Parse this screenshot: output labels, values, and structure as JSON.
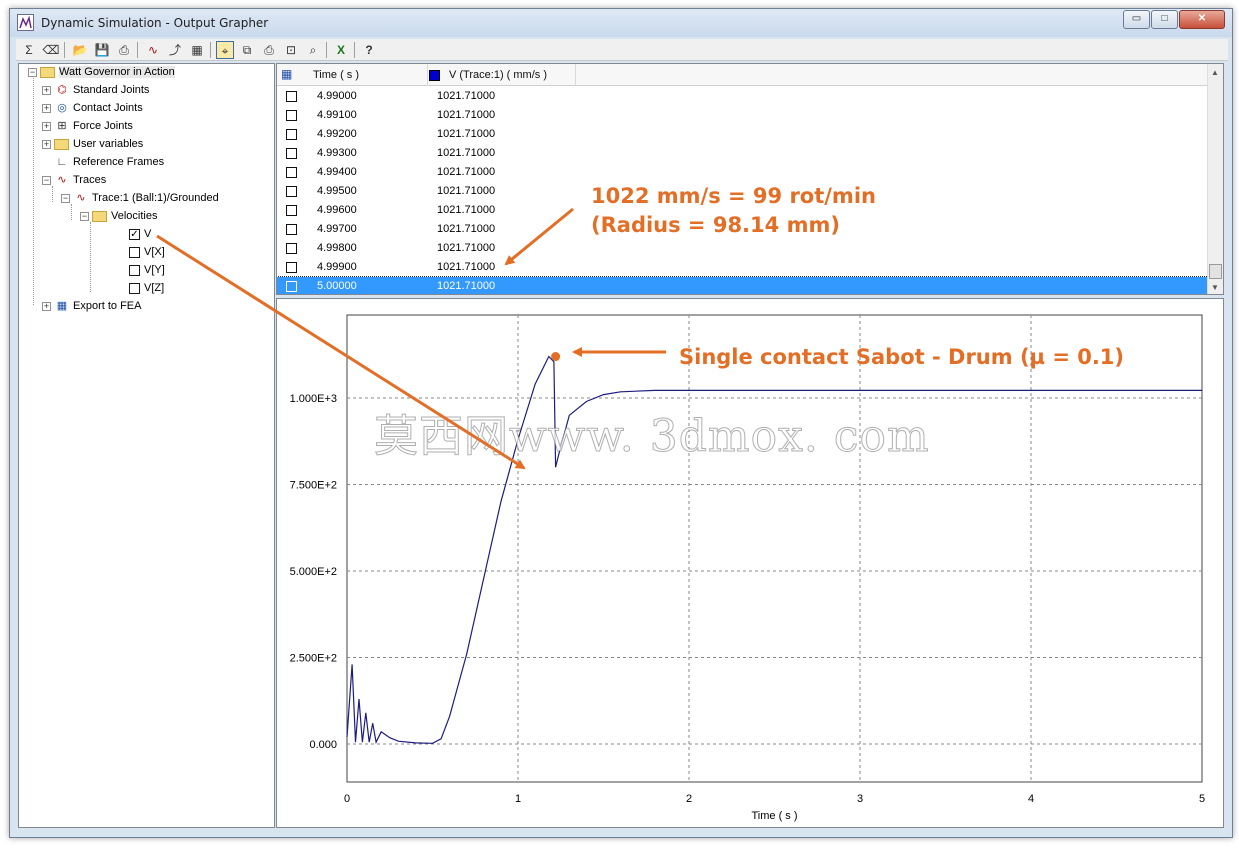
{
  "window": {
    "title": "Dynamic Simulation - Output Grapher",
    "controls": [
      "▭",
      "□",
      "✕"
    ]
  },
  "toolbar": {
    "icons": [
      "calc-icon",
      "eraser-icon",
      "open-icon",
      "save-icon",
      "export-icon",
      "trace-icon",
      "add-axis-icon",
      "fea-icon",
      "curve-select-icon",
      "copy-icon",
      "print-icon",
      "zoom-fit-icon",
      "zoom-icon",
      "excel-icon",
      "help-icon"
    ],
    "glyphs": [
      "Σ",
      "⌫",
      "📂",
      "💾",
      "⎙",
      "∿",
      "⤴",
      "▦",
      "⌖",
      "⧉",
      "⎙",
      "⊡",
      "⌕",
      "X",
      "?"
    ]
  },
  "tree": {
    "root": "Watt Governor in Action",
    "items": {
      "standard_joints": "Standard Joints",
      "contact_joints": "Contact Joints",
      "force_joints": "Force Joints",
      "user_variables": "User variables",
      "reference_frames": "Reference Frames",
      "traces": "Traces",
      "trace1": "Trace:1 (Ball:1)/Grounded",
      "velocities": "Velocities",
      "v": "V",
      "vx": "V[X]",
      "vy": "V[Y]",
      "vz": "V[Z]",
      "export_fea": "Export to FEA"
    }
  },
  "table": {
    "col_time": "Time ( s )",
    "col_v": "V (Trace:1) ( mm/s )",
    "rows": [
      [
        "4.99000",
        "1021.71000"
      ],
      [
        "4.99100",
        "1021.71000"
      ],
      [
        "4.99200",
        "1021.71000"
      ],
      [
        "4.99300",
        "1021.71000"
      ],
      [
        "4.99400",
        "1021.71000"
      ],
      [
        "4.99500",
        "1021.71000"
      ],
      [
        "4.99600",
        "1021.71000"
      ],
      [
        "4.99700",
        "1021.71000"
      ],
      [
        "4.99800",
        "1021.71000"
      ],
      [
        "4.99900",
        "1021.71000"
      ],
      [
        "5.00000",
        "1021.71000"
      ]
    ]
  },
  "annotations": {
    "rpm_line1": "1022 mm/s = 99 rot/min",
    "rpm_line2": "(Radius = 98.14 mm)",
    "contact": "Single contact Sabot - Drum (µ = 0.1)"
  },
  "watermark": "莫西网www. 3dmox. com",
  "colors": {
    "series": "#1c1c80",
    "annotation": "#e36e26",
    "selection": "#3399ff"
  },
  "chart_data": {
    "type": "line",
    "xlabel": "Time ( s )",
    "ylabel": "",
    "xlim": [
      0,
      5
    ],
    "ylim": [
      -110,
      1240
    ],
    "xticks": [
      "0",
      "1",
      "2",
      "3",
      "4",
      "5"
    ],
    "yticks": [
      {
        "value": 0,
        "label": "0.000"
      },
      {
        "value": 250,
        "label": "2.500E+2"
      },
      {
        "value": 500,
        "label": "5.000E+2"
      },
      {
        "value": 750,
        "label": "7.500E+2"
      },
      {
        "value": 1000,
        "label": "1.000E+3"
      }
    ],
    "grid": true,
    "series": [
      {
        "color": "#1c1c80",
        "x": [
          0.0,
          0.03,
          0.05,
          0.07,
          0.09,
          0.11,
          0.13,
          0.15,
          0.17,
          0.2,
          0.25,
          0.3,
          0.4,
          0.5,
          0.55,
          0.6,
          0.7,
          0.8,
          0.9,
          1.0,
          1.1,
          1.18,
          1.21,
          1.22,
          1.24,
          1.3,
          1.4,
          1.5,
          1.6,
          1.8,
          2.0,
          3.0,
          4.0,
          5.0
        ],
        "y": [
          20,
          230,
          5,
          130,
          5,
          90,
          5,
          60,
          5,
          35,
          18,
          8,
          3,
          2,
          15,
          80,
          260,
          480,
          700,
          880,
          1040,
          1120,
          1105,
          800,
          840,
          950,
          990,
          1010,
          1018,
          1022,
          1022,
          1022,
          1022,
          1022
        ]
      }
    ],
    "annotations": [
      {
        "x": 1.22,
        "y": 1120,
        "text": "Single contact Sabot - Drum (µ = 0.1)"
      }
    ]
  }
}
